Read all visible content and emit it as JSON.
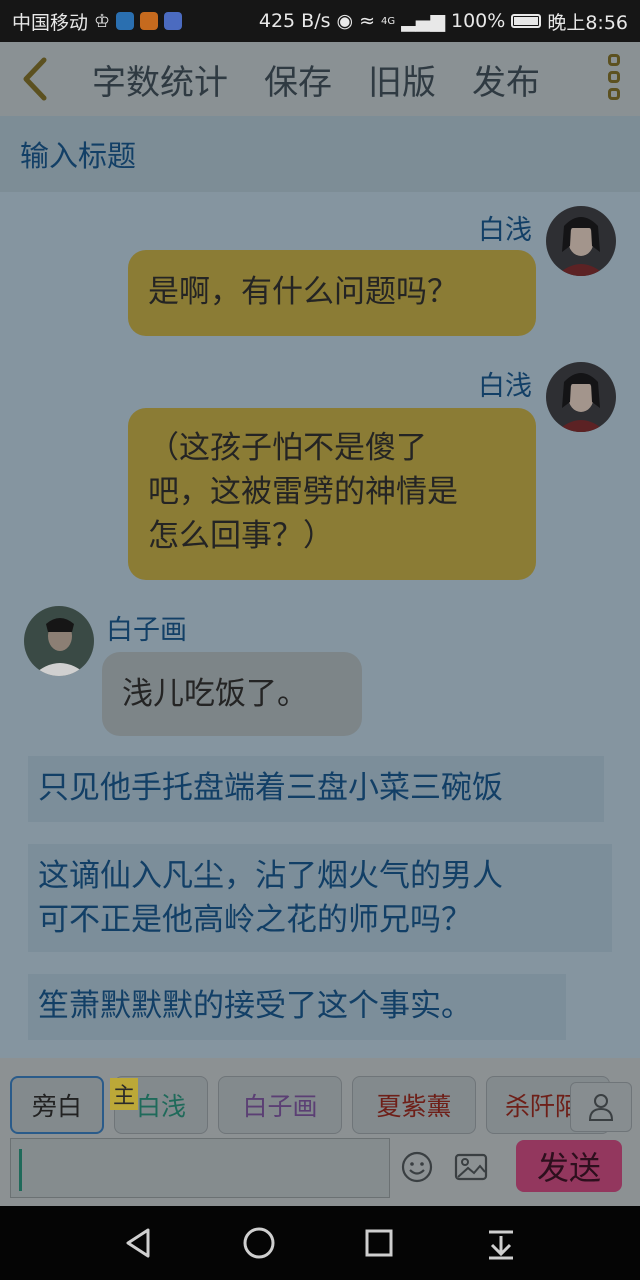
{
  "status_bar": {
    "carrier": "中国移动",
    "speed": "425 B/s",
    "network": "4G",
    "battery": "100%",
    "time": "晚上8:56"
  },
  "toolbar": {
    "word_count": "字数统计",
    "save": "保存",
    "old_version": "旧版",
    "publish": "发布"
  },
  "title_placeholder": "输入标题",
  "messages": [
    {
      "speaker": "白浅",
      "text": "是啊，有什么问题吗？"
    },
    {
      "speaker": "白浅",
      "lines": [
        "（这孩子怕不是傻了",
        "吧，这被雷劈的神情是",
        "怎么回事？）"
      ]
    },
    {
      "speaker": "白子画",
      "text": "浅儿吃饭了。"
    }
  ],
  "narration": [
    {
      "lines": [
        "只见他手托盘端着三盘小菜三碗饭"
      ]
    },
    {
      "lines": [
        "这谪仙入凡尘，沾了烟火气的男人",
        "可不正是他高岭之花的师兄吗？"
      ]
    },
    {
      "lines": [
        "笙萧默默默的接受了这个事实。"
      ]
    }
  ],
  "roles": {
    "narrator": "旁白",
    "main_tag": "主",
    "items": [
      "白浅",
      "白子画",
      "夏紫薰",
      "杀阡陌"
    ]
  },
  "input": {
    "value": "",
    "send": "发送"
  },
  "colors": {
    "bubble_self": "#8b7c35",
    "bubble_other": "#7d8588",
    "narration_text": "#123f66",
    "send_button": "#93375e"
  }
}
